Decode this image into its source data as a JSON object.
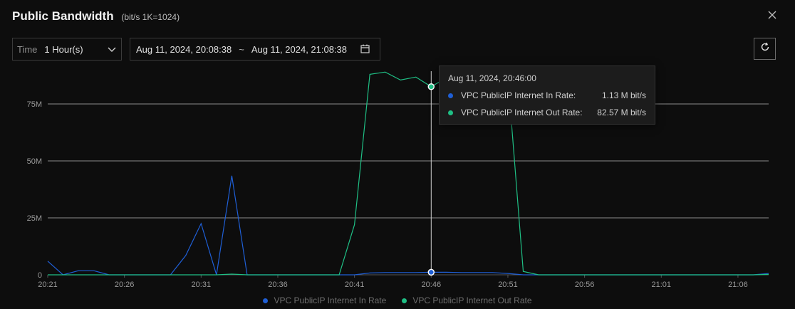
{
  "header": {
    "title": "Public Bandwidth",
    "subtitle": "(bit/s  1K=1024)"
  },
  "toolbar": {
    "time_label": "Time",
    "time_value": "1 Hour(s)",
    "range_start": "Aug 11, 2024, 20:08:38",
    "range_sep": "~",
    "range_end": "Aug 11, 2024, 21:08:38"
  },
  "icons": {
    "close": "close-icon",
    "dropdown": "chevron-down-icon",
    "calendar": "calendar-icon",
    "refresh": "refresh-icon"
  },
  "tooltip": {
    "time": "Aug 11, 2024, 20:46:00",
    "rows": [
      {
        "name": "VPC PublicIP Internet In Rate:",
        "value": "1.13 M bit/s",
        "color": "#1f5fd6"
      },
      {
        "name": "VPC PublicIP Internet Out Rate:",
        "value": "82.57 M bit/s",
        "color": "#1fbf85"
      }
    ]
  },
  "chart_data": {
    "type": "line",
    "title": "Public Bandwidth",
    "ylabel": "",
    "xlabel": "",
    "x": [
      "20:21",
      "20:22",
      "20:23",
      "20:24",
      "20:25",
      "20:26",
      "20:27",
      "20:28",
      "20:29",
      "20:30",
      "20:31",
      "20:32",
      "20:33",
      "20:34",
      "20:35",
      "20:36",
      "20:37",
      "20:38",
      "20:39",
      "20:40",
      "20:41",
      "20:42",
      "20:43",
      "20:44",
      "20:45",
      "20:46",
      "20:47",
      "20:48",
      "20:49",
      "20:50",
      "20:51",
      "20:52",
      "20:53",
      "20:54",
      "20:55",
      "20:56",
      "20:57",
      "20:58",
      "20:59",
      "21:00",
      "21:01",
      "21:02",
      "21:03",
      "21:04",
      "21:05",
      "21:06",
      "21:07",
      "21:08"
    ],
    "x_ticks": [
      "20:21",
      "20:26",
      "20:31",
      "20:36",
      "20:41",
      "20:46",
      "20:51",
      "20:56",
      "21:01",
      "21:06"
    ],
    "y_ticks": [
      0,
      25,
      50,
      75
    ],
    "y_tick_labels": [
      "0",
      "25M",
      "50M",
      "75M"
    ],
    "ylim": [
      0,
      90
    ],
    "y_unit": "M bit/s",
    "grid": "horizontal",
    "legend_position": "bottom",
    "series": [
      {
        "name": "VPC PublicIP Internet In Rate",
        "color": "#1f5fd6",
        "values": [
          6,
          0,
          1.8,
          1.8,
          0,
          0,
          0,
          0,
          0,
          8.5,
          22.5,
          0,
          43.5,
          0,
          0,
          0,
          0,
          0,
          0,
          0,
          0,
          0.8,
          1,
          1,
          1,
          1.13,
          1.13,
          1,
          1,
          1,
          0.6,
          0,
          0,
          0,
          0,
          0,
          0,
          0,
          0,
          0,
          0,
          0,
          0,
          0,
          0,
          0,
          0,
          0.6
        ]
      },
      {
        "name": "VPC PublicIP Internet Out Rate",
        "color": "#1fbf85",
        "values": [
          0,
          0,
          0,
          0,
          0,
          0,
          0,
          0,
          0,
          0,
          0,
          0,
          0.3,
          0,
          0,
          0,
          0,
          0,
          0,
          0,
          22,
          88,
          89,
          85.5,
          86.8,
          82.57,
          86.5,
          87,
          86,
          85.5,
          86.5,
          1.5,
          0,
          0,
          0,
          0,
          0,
          0,
          0,
          0,
          0,
          0,
          0,
          0,
          0,
          0,
          0,
          0.2
        ]
      }
    ],
    "hover_x": "20:46"
  }
}
